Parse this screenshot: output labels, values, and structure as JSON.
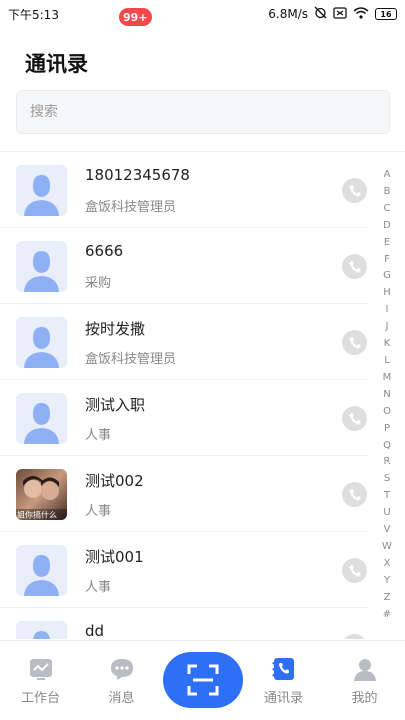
{
  "status_bar": {
    "time": "下午5:13",
    "network_speed": "6.8M/s",
    "battery": "16"
  },
  "page": {
    "title": "通讯录"
  },
  "search": {
    "placeholder": "搜索"
  },
  "contacts": [
    {
      "name": "18012345678",
      "role": "盒饭科技管理员",
      "avatar": "default"
    },
    {
      "name": "6666",
      "role": "采购",
      "avatar": "default"
    },
    {
      "name": "按时发撒",
      "role": "盒饭科技管理员",
      "avatar": "default"
    },
    {
      "name": "测试入职",
      "role": "人事",
      "avatar": "default"
    },
    {
      "name": "测试002",
      "role": "人事",
      "avatar": "photo",
      "avatar_caption": "姐你搞什么"
    },
    {
      "name": "测试001",
      "role": "人事",
      "avatar": "default"
    },
    {
      "name": "dd",
      "role": "",
      "avatar": "default"
    }
  ],
  "alpha_index": [
    "A",
    "B",
    "C",
    "D",
    "E",
    "F",
    "G",
    "H",
    "I",
    "J",
    "K",
    "L",
    "M",
    "N",
    "O",
    "P",
    "Q",
    "R",
    "S",
    "T",
    "U",
    "V",
    "W",
    "X",
    "Y",
    "Z",
    "#"
  ],
  "tabs": [
    {
      "label": "工作台",
      "icon": "workbench-icon",
      "active": false
    },
    {
      "label": "消息",
      "icon": "message-icon",
      "active": false,
      "badge": "99+"
    },
    {
      "label": "",
      "icon": "scan-icon",
      "active": false
    },
    {
      "label": "通讯录",
      "icon": "contacts-icon",
      "active": true
    },
    {
      "label": "我的",
      "icon": "profile-icon",
      "active": false
    }
  ],
  "colors": {
    "accent": "#2d6ff5",
    "badge": "#f5484c",
    "avatar_bg": "#e8effb",
    "avatar_fg": "#8fb0f5"
  }
}
